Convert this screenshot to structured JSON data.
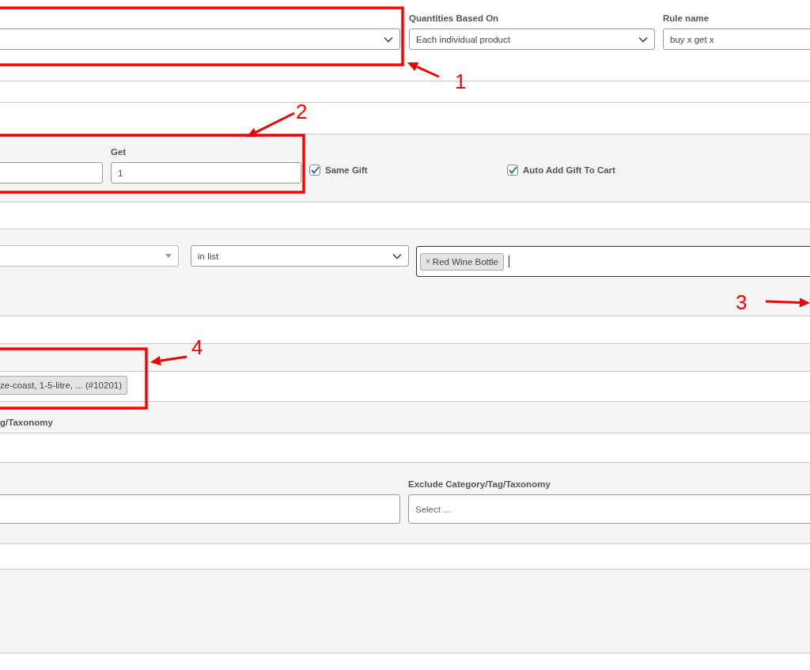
{
  "rule_settings": {
    "quantities_based_on": {
      "label": "Quantities Based On",
      "value": "Each individual product"
    },
    "rule_name": {
      "label": "Rule name",
      "value": "buy x get x"
    }
  },
  "gift": {
    "get": {
      "label": "Get",
      "value": "1"
    },
    "options": [
      {
        "label": "Same Gift",
        "checked": true
      },
      {
        "label": "Auto Add Gift To Cart",
        "checked": true
      }
    ]
  },
  "condition": {
    "operator": {
      "value": "in list"
    },
    "products": {
      "tags": [
        {
          "remove": "×",
          "label": "Red Wine Bottle"
        }
      ]
    }
  },
  "product_chip": {
    "text": "ze-coast, 1-5-litre, ... (#10201)"
  },
  "category_label": "g/Taxonomy",
  "exclude": {
    "label": "Exclude Category/Tag/Taxonomy",
    "placeholder": "Select ..."
  },
  "annotations": [
    {
      "number": "1"
    },
    {
      "number": "2"
    },
    {
      "number": "3"
    },
    {
      "number": "4"
    }
  ]
}
